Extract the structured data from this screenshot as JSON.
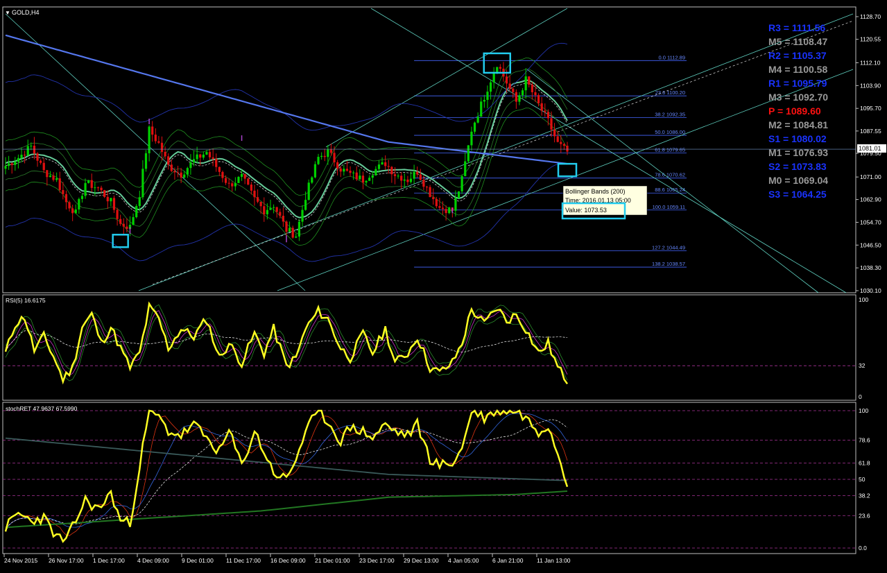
{
  "window": {
    "symbol_label": "GOLD,H4",
    "menu_glyph": "▼"
  },
  "colors": {
    "background": "#000000",
    "frame": "#c0c0c0",
    "bull_candle": "#00d000",
    "bear_candle": "#e01010",
    "rsi_line": "#ffff22",
    "stoch_line": "#ffff22",
    "ma_blue": "#5577ee",
    "bb_green": "#1f8f1f",
    "channel_cyan": "#5fd0c0",
    "fib_blue": "#4466ff",
    "highlight_box": "#22ccee",
    "pivot_resistance": "#1a33ff",
    "pivot_mid": "#9a9a9a",
    "pivot_p": "#ff1111"
  },
  "chart_data": [
    {
      "type": "candlestick",
      "name": "GOLD,H4",
      "x_labels": [
        "24 Nov 2015",
        "26 Nov 17:00",
        "1 Dec 17:00",
        "4 Dec 09:00",
        "9 Dec 01:00",
        "11 Dec 17:00",
        "16 Dec 09:00",
        "21 Dec 01:00",
        "23 Dec 17:00",
        "29 Dec 13:00",
        "4 Jan 05:00",
        "6 Jan 21:00",
        "11 Jan 13:00"
      ],
      "y_ticks": [
        "1128.70",
        "1120.55",
        "1112.10",
        "1103.90",
        "1095.70",
        "1087.55",
        "1079.50",
        "1071.00",
        "1062.90",
        "1054.70",
        "1046.50",
        "1038.30",
        "1030.10"
      ],
      "ylim": [
        1030.1,
        1128.7
      ],
      "current_price": "1081.01",
      "close_path": [
        [
          0,
          1075
        ],
        [
          4,
          1078
        ],
        [
          8,
          1082
        ],
        [
          12,
          1073
        ],
        [
          16,
          1070
        ],
        [
          19,
          1062
        ],
        [
          22,
          1058
        ],
        [
          25,
          1069
        ],
        [
          29,
          1067
        ],
        [
          33,
          1062
        ],
        [
          36,
          1054
        ],
        [
          39,
          1053
        ],
        [
          42,
          1065
        ],
        [
          45,
          1088
        ],
        [
          48,
          1083
        ],
        [
          51,
          1075
        ],
        [
          55,
          1072
        ],
        [
          59,
          1077
        ],
        [
          63,
          1080
        ],
        [
          67,
          1073
        ],
        [
          70,
          1068
        ],
        [
          74,
          1071
        ],
        [
          78,
          1063
        ],
        [
          81,
          1059
        ],
        [
          84,
          1061
        ],
        [
          88,
          1052
        ],
        [
          91,
          1050
        ],
        [
          94,
          1064
        ],
        [
          98,
          1078
        ],
        [
          101,
          1080
        ],
        [
          105,
          1074
        ],
        [
          108,
          1072
        ],
        [
          112,
          1070
        ],
        [
          115,
          1073
        ],
        [
          119,
          1076
        ],
        [
          122,
          1072
        ],
        [
          126,
          1070
        ],
        [
          129,
          1073
        ],
        [
          133,
          1065
        ],
        [
          136,
          1060
        ],
        [
          140,
          1059
        ],
        [
          143,
          1070
        ],
        [
          146,
          1088
        ],
        [
          150,
          1100
        ],
        [
          154,
          1112
        ],
        [
          157,
          1105
        ],
        [
          160,
          1098
        ],
        [
          163,
          1106
        ],
        [
          167,
          1097
        ],
        [
          170,
          1091
        ],
        [
          173,
          1083
        ],
        [
          176,
          1080
        ]
      ],
      "annotations": {
        "pivot_levels": [
          {
            "label": "R3 = 1111.56",
            "kind": "resistance"
          },
          {
            "label": "M5 = 1108.47",
            "kind": "mid"
          },
          {
            "label": "R2 = 1105.37",
            "kind": "resistance"
          },
          {
            "label": "M4 = 1100.58",
            "kind": "mid"
          },
          {
            "label": "R1 = 1095.79",
            "kind": "resistance"
          },
          {
            "label": "M3 = 1092.70",
            "kind": "mid"
          },
          {
            "label": "P  = 1089.60",
            "kind": "pivot"
          },
          {
            "label": "M2 = 1084.81",
            "kind": "mid"
          },
          {
            "label": "S1 = 1080.02",
            "kind": "resistance"
          },
          {
            "label": "M1 = 1076.93",
            "kind": "mid"
          },
          {
            "label": "S2 = 1073.83",
            "kind": "resistance"
          },
          {
            "label": "M0 = 1069.04",
            "kind": "mid"
          },
          {
            "label": "S3 = 1064.25",
            "kind": "resistance"
          }
        ],
        "fibonacci": [
          {
            "label": "0.0  1112.89",
            "price": 1112.89
          },
          {
            "label": "23.6  1100.20",
            "price": 1100.2
          },
          {
            "label": "38.2  1092.35",
            "price": 1092.35
          },
          {
            "label": "50.0  1086.00",
            "price": 1086.0
          },
          {
            "label": "61.8  1079.65",
            "price": 1079.65
          },
          {
            "label": "78.6  1070.62",
            "price": 1070.62
          },
          {
            "label": "88.6  1065.24",
            "price": 1065.24
          },
          {
            "label": "100.0  1059.11",
            "price": 1059.11
          },
          {
            "label": "127.2  1044.49",
            "price": 1044.49
          },
          {
            "label": "138.2  1038.57",
            "price": 1038.57
          }
        ],
        "tooltip": {
          "name": "Bollinger Bands (200)",
          "time": "Time: 2016.01.13 05:00",
          "value": "Value: 1073.53"
        }
      }
    },
    {
      "type": "line",
      "name": "RSI(5) 16.6175",
      "y_ticks": [
        "100",
        "32",
        "0"
      ],
      "ylim": [
        0,
        100
      ],
      "levels": [
        32
      ],
      "series_path": [
        [
          0,
          45
        ],
        [
          3,
          75
        ],
        [
          6,
          82
        ],
        [
          9,
          48
        ],
        [
          12,
          62
        ],
        [
          15,
          42
        ],
        [
          18,
          18
        ],
        [
          21,
          30
        ],
        [
          24,
          72
        ],
        [
          27,
          85
        ],
        [
          30,
          55
        ],
        [
          33,
          72
        ],
        [
          36,
          50
        ],
        [
          39,
          30
        ],
        [
          42,
          45
        ],
        [
          45,
          92
        ],
        [
          48,
          80
        ],
        [
          51,
          50
        ],
        [
          55,
          70
        ],
        [
          59,
          62
        ],
        [
          63,
          80
        ],
        [
          67,
          40
        ],
        [
          70,
          55
        ],
        [
          74,
          35
        ],
        [
          78,
          65
        ],
        [
          81,
          45
        ],
        [
          84,
          70
        ],
        [
          88,
          32
        ],
        [
          91,
          40
        ],
        [
          94,
          70
        ],
        [
          98,
          88
        ],
        [
          101,
          80
        ],
        [
          105,
          50
        ],
        [
          108,
          40
        ],
        [
          112,
          65
        ],
        [
          115,
          45
        ],
        [
          119,
          70
        ],
        [
          122,
          35
        ],
        [
          126,
          45
        ],
        [
          129,
          62
        ],
        [
          133,
          30
        ],
        [
          136,
          25
        ],
        [
          140,
          35
        ],
        [
          143,
          55
        ],
        [
          146,
          90
        ],
        [
          150,
          75
        ],
        [
          154,
          92
        ],
        [
          157,
          78
        ],
        [
          160,
          85
        ],
        [
          163,
          70
        ],
        [
          167,
          45
        ],
        [
          170,
          55
        ],
        [
          173,
          30
        ],
        [
          176,
          16.6
        ]
      ]
    },
    {
      "type": "line",
      "name": "stochRET 47.9637 67.5990",
      "y_ticks": [
        "100",
        "78.6",
        "61.8",
        "50",
        "38.2",
        "23.6",
        "0.0"
      ],
      "ylim": [
        0,
        100
      ],
      "levels": [
        100,
        78.6,
        61.8,
        50,
        38.2,
        23.6,
        0.0
      ],
      "series_path": [
        [
          0,
          15
        ],
        [
          4,
          25
        ],
        [
          8,
          20
        ],
        [
          12,
          22
        ],
        [
          16,
          8
        ],
        [
          19,
          5
        ],
        [
          22,
          20
        ],
        [
          25,
          35
        ],
        [
          29,
          28
        ],
        [
          33,
          40
        ],
        [
          36,
          20
        ],
        [
          39,
          18
        ],
        [
          42,
          60
        ],
        [
          45,
          100
        ],
        [
          48,
          95
        ],
        [
          51,
          85
        ],
        [
          55,
          82
        ],
        [
          59,
          90
        ],
        [
          63,
          80
        ],
        [
          67,
          70
        ],
        [
          70,
          85
        ],
        [
          74,
          60
        ],
        [
          78,
          85
        ],
        [
          81,
          70
        ],
        [
          84,
          55
        ],
        [
          88,
          50
        ],
        [
          91,
          65
        ],
        [
          94,
          85
        ],
        [
          98,
          100
        ],
        [
          101,
          92
        ],
        [
          105,
          78
        ],
        [
          108,
          88
        ],
        [
          112,
          85
        ],
        [
          115,
          80
        ],
        [
          119,
          90
        ],
        [
          122,
          85
        ],
        [
          126,
          82
        ],
        [
          129,
          90
        ],
        [
          133,
          65
        ],
        [
          136,
          60
        ],
        [
          140,
          62
        ],
        [
          143,
          72
        ],
        [
          146,
          100
        ],
        [
          150,
          95
        ],
        [
          154,
          100
        ],
        [
          157,
          100
        ],
        [
          160,
          100
        ],
        [
          163,
          95
        ],
        [
          167,
          85
        ],
        [
          170,
          90
        ],
        [
          173,
          70
        ],
        [
          176,
          48
        ]
      ]
    }
  ]
}
